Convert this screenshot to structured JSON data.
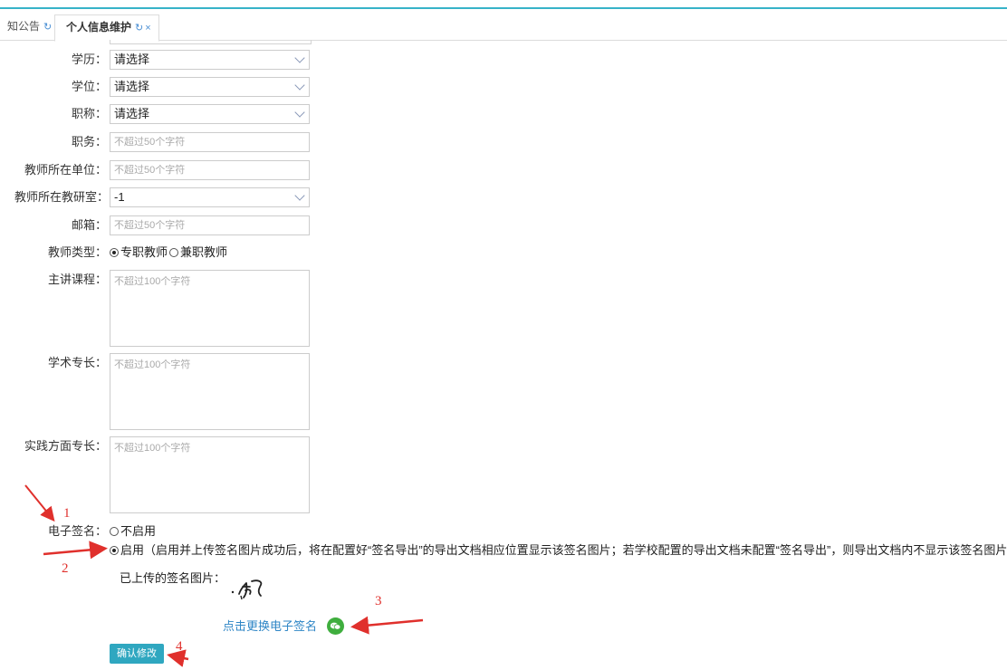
{
  "tabs": [
    {
      "label": "知公告",
      "icon": "refresh-icon"
    },
    {
      "label": "个人信息维护",
      "icon": "refresh-icon",
      "close_icon": "close-icon",
      "active": true
    }
  ],
  "icon_glyphs": {
    "refresh": "↻",
    "close": "×"
  },
  "form": {
    "education": {
      "label": "学历：",
      "value": "请选择"
    },
    "degree": {
      "label": "学位：",
      "value": "请选择"
    },
    "title": {
      "label": "职称：",
      "value": "请选择"
    },
    "position": {
      "label": "职务：",
      "placeholder": "不超过50个字符"
    },
    "unit": {
      "label": "教师所在单位：",
      "placeholder": "不超过50个字符"
    },
    "office": {
      "label": "教师所在教研室：",
      "value": "-1"
    },
    "email": {
      "label": "邮箱：",
      "placeholder": "不超过50个字符"
    },
    "teacher_type": {
      "label": "教师类型：",
      "options": [
        "专职教师",
        "兼职教师"
      ],
      "selected": "专职教师"
    },
    "main_course": {
      "label": "主讲课程：",
      "placeholder": "不超过100个字符"
    },
    "academic": {
      "label": "学术专长：",
      "placeholder": "不超过100个字符"
    },
    "practice": {
      "label": "实践方面专长：",
      "placeholder": "不超过100个字符"
    },
    "esign": {
      "label": "电子签名：",
      "option_disable": "不启用",
      "option_enable": "启用（启用并上传签名图片成功后，将在配置好“签名导出”的导出文档相应位置显示该签名图片；若学校配置的导出文档未配置“签名导出”，则导出文档内不显示该签名图片）",
      "selected": "启用",
      "uploaded_label": "已上传的签名图片：",
      "change_link": "点击更换电子签名",
      "wechat_icon": "wechat-icon"
    },
    "submit_label": "确认修改"
  },
  "annotations": [
    "1",
    "2",
    "3",
    "4"
  ],
  "colors": {
    "accent": "#2fa7c0",
    "link": "#2f86c6",
    "annotation": "#e0302c",
    "wechat": "#3fae3e"
  }
}
